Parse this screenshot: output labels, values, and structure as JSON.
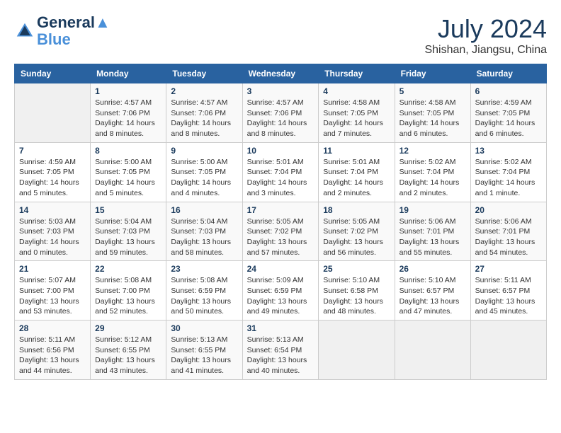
{
  "header": {
    "logo_line1": "General",
    "logo_line2": "Blue",
    "month": "July 2024",
    "location": "Shishan, Jiangsu, China"
  },
  "columns": [
    "Sunday",
    "Monday",
    "Tuesday",
    "Wednesday",
    "Thursday",
    "Friday",
    "Saturday"
  ],
  "weeks": [
    [
      {
        "day": "",
        "info": ""
      },
      {
        "day": "1",
        "info": "Sunrise: 4:57 AM\nSunset: 7:06 PM\nDaylight: 14 hours\nand 8 minutes."
      },
      {
        "day": "2",
        "info": "Sunrise: 4:57 AM\nSunset: 7:06 PM\nDaylight: 14 hours\nand 8 minutes."
      },
      {
        "day": "3",
        "info": "Sunrise: 4:57 AM\nSunset: 7:06 PM\nDaylight: 14 hours\nand 8 minutes."
      },
      {
        "day": "4",
        "info": "Sunrise: 4:58 AM\nSunset: 7:05 PM\nDaylight: 14 hours\nand 7 minutes."
      },
      {
        "day": "5",
        "info": "Sunrise: 4:58 AM\nSunset: 7:05 PM\nDaylight: 14 hours\nand 6 minutes."
      },
      {
        "day": "6",
        "info": "Sunrise: 4:59 AM\nSunset: 7:05 PM\nDaylight: 14 hours\nand 6 minutes."
      }
    ],
    [
      {
        "day": "7",
        "info": "Sunrise: 4:59 AM\nSunset: 7:05 PM\nDaylight: 14 hours\nand 5 minutes."
      },
      {
        "day": "8",
        "info": "Sunrise: 5:00 AM\nSunset: 7:05 PM\nDaylight: 14 hours\nand 5 minutes."
      },
      {
        "day": "9",
        "info": "Sunrise: 5:00 AM\nSunset: 7:05 PM\nDaylight: 14 hours\nand 4 minutes."
      },
      {
        "day": "10",
        "info": "Sunrise: 5:01 AM\nSunset: 7:04 PM\nDaylight: 14 hours\nand 3 minutes."
      },
      {
        "day": "11",
        "info": "Sunrise: 5:01 AM\nSunset: 7:04 PM\nDaylight: 14 hours\nand 2 minutes."
      },
      {
        "day": "12",
        "info": "Sunrise: 5:02 AM\nSunset: 7:04 PM\nDaylight: 14 hours\nand 2 minutes."
      },
      {
        "day": "13",
        "info": "Sunrise: 5:02 AM\nSunset: 7:04 PM\nDaylight: 14 hours\nand 1 minute."
      }
    ],
    [
      {
        "day": "14",
        "info": "Sunrise: 5:03 AM\nSunset: 7:03 PM\nDaylight: 14 hours\nand 0 minutes."
      },
      {
        "day": "15",
        "info": "Sunrise: 5:04 AM\nSunset: 7:03 PM\nDaylight: 13 hours\nand 59 minutes."
      },
      {
        "day": "16",
        "info": "Sunrise: 5:04 AM\nSunset: 7:03 PM\nDaylight: 13 hours\nand 58 minutes."
      },
      {
        "day": "17",
        "info": "Sunrise: 5:05 AM\nSunset: 7:02 PM\nDaylight: 13 hours\nand 57 minutes."
      },
      {
        "day": "18",
        "info": "Sunrise: 5:05 AM\nSunset: 7:02 PM\nDaylight: 13 hours\nand 56 minutes."
      },
      {
        "day": "19",
        "info": "Sunrise: 5:06 AM\nSunset: 7:01 PM\nDaylight: 13 hours\nand 55 minutes."
      },
      {
        "day": "20",
        "info": "Sunrise: 5:06 AM\nSunset: 7:01 PM\nDaylight: 13 hours\nand 54 minutes."
      }
    ],
    [
      {
        "day": "21",
        "info": "Sunrise: 5:07 AM\nSunset: 7:00 PM\nDaylight: 13 hours\nand 53 minutes."
      },
      {
        "day": "22",
        "info": "Sunrise: 5:08 AM\nSunset: 7:00 PM\nDaylight: 13 hours\nand 52 minutes."
      },
      {
        "day": "23",
        "info": "Sunrise: 5:08 AM\nSunset: 6:59 PM\nDaylight: 13 hours\nand 50 minutes."
      },
      {
        "day": "24",
        "info": "Sunrise: 5:09 AM\nSunset: 6:59 PM\nDaylight: 13 hours\nand 49 minutes."
      },
      {
        "day": "25",
        "info": "Sunrise: 5:10 AM\nSunset: 6:58 PM\nDaylight: 13 hours\nand 48 minutes."
      },
      {
        "day": "26",
        "info": "Sunrise: 5:10 AM\nSunset: 6:57 PM\nDaylight: 13 hours\nand 47 minutes."
      },
      {
        "day": "27",
        "info": "Sunrise: 5:11 AM\nSunset: 6:57 PM\nDaylight: 13 hours\nand 45 minutes."
      }
    ],
    [
      {
        "day": "28",
        "info": "Sunrise: 5:11 AM\nSunset: 6:56 PM\nDaylight: 13 hours\nand 44 minutes."
      },
      {
        "day": "29",
        "info": "Sunrise: 5:12 AM\nSunset: 6:55 PM\nDaylight: 13 hours\nand 43 minutes."
      },
      {
        "day": "30",
        "info": "Sunrise: 5:13 AM\nSunset: 6:55 PM\nDaylight: 13 hours\nand 41 minutes."
      },
      {
        "day": "31",
        "info": "Sunrise: 5:13 AM\nSunset: 6:54 PM\nDaylight: 13 hours\nand 40 minutes."
      },
      {
        "day": "",
        "info": ""
      },
      {
        "day": "",
        "info": ""
      },
      {
        "day": "",
        "info": ""
      }
    ]
  ]
}
